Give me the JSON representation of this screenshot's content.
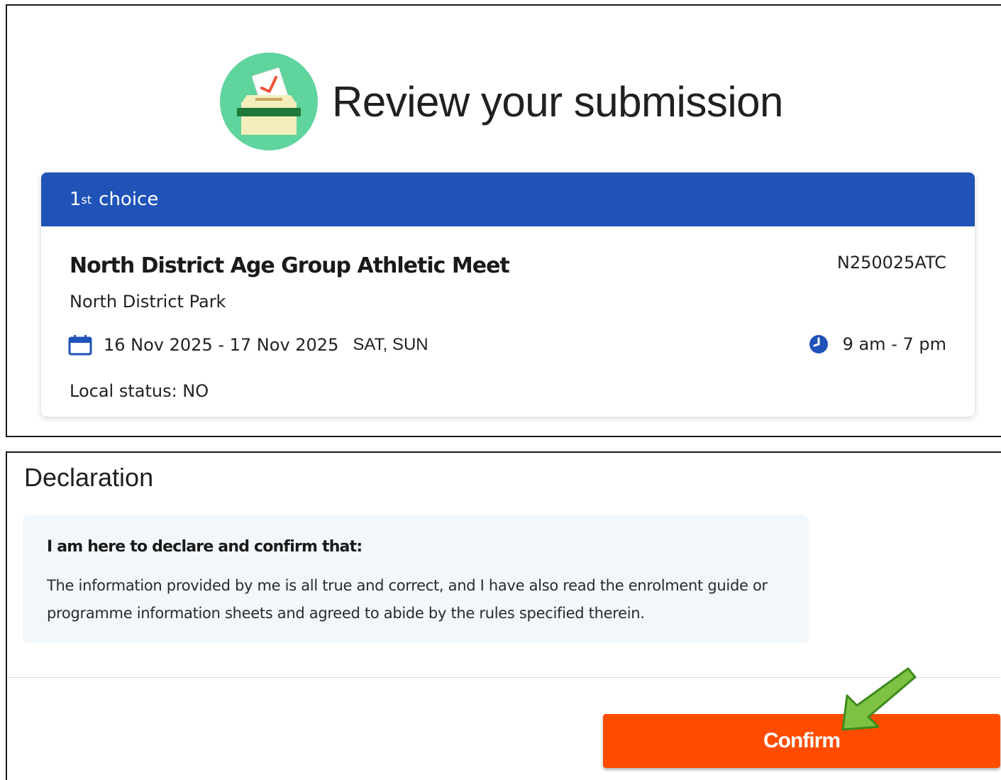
{
  "header": {
    "title": "Review your submission",
    "logo_icon": "ballot-box-icon"
  },
  "choice": {
    "ordinal_number": "1",
    "ordinal_suffix": "st",
    "label": "choice",
    "event_name": "North District Age Group Athletic Meet",
    "event_code": "N250025ATC",
    "venue": "North District Park",
    "date_range": "16 Nov 2025 - 17 Nov 2025",
    "days": "SAT, SUN",
    "time_range": "9 am - 7 pm",
    "local_status": "Local status: NO",
    "date_icon": "calendar-icon",
    "time_icon": "clock-icon"
  },
  "declaration": {
    "title": "Declaration",
    "heading": "I am here to declare and confirm that:",
    "body": "The information provided by me is all true and correct, and I have also read the enrolment guide or programme information sheets and agreed to abide by the rules specified therein."
  },
  "actions": {
    "confirm_label": "Confirm"
  },
  "colors": {
    "header_blue": "#1f53b8",
    "confirm_orange": "#ff4c00",
    "logo_green": "#5fd49c",
    "arrow_green": "#7dc242",
    "declaration_bg": "#f1f7fb"
  }
}
